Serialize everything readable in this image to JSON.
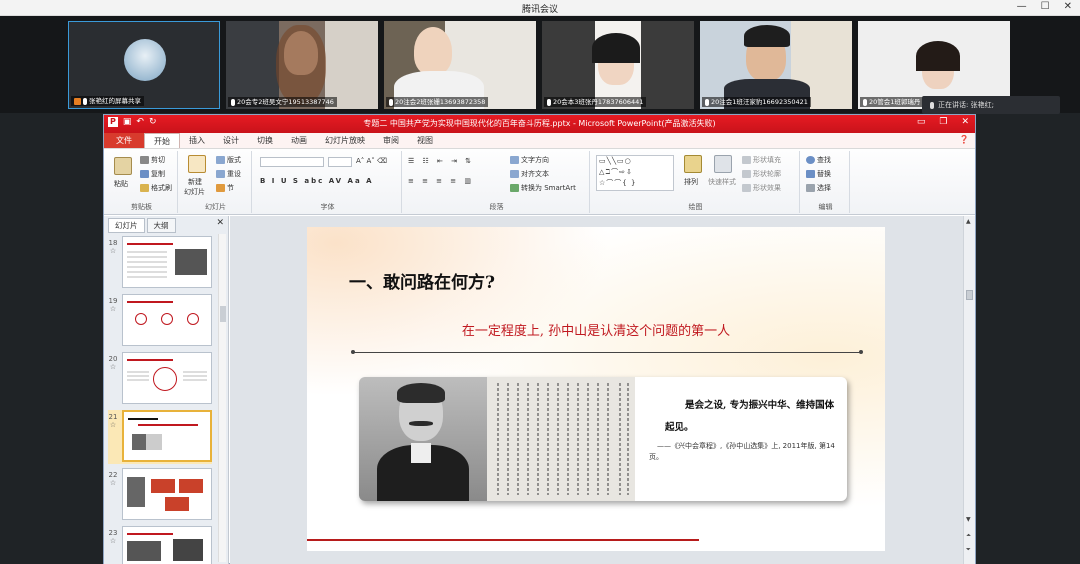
{
  "meeting": {
    "window_title": "腾讯会议",
    "speaking_label": "正在讲话: 张艳红;",
    "participants": [
      {
        "name": "张艳红的屏幕共享"
      },
      {
        "name": "20会专2班吴文宁19513387746"
      },
      {
        "name": "20注会2班张姗13693872358"
      },
      {
        "name": "20会本3班张丹17837606441"
      },
      {
        "name": "20注会1班汪家豹16692350421"
      },
      {
        "name": "20管会1班郭瑞丹"
      }
    ]
  },
  "ppt": {
    "doc_title": "专题二 中国共产党为实现中国现代化的百年奋斗历程.pptx - Microsoft PowerPoint(产品激活失败)",
    "tabs": [
      "文件",
      "开始",
      "插入",
      "设计",
      "切换",
      "动画",
      "幻灯片放映",
      "审阅",
      "视图"
    ],
    "selected_tab": "开始",
    "ribbon": {
      "clipboard": {
        "name": "剪贴板",
        "paste": "粘贴",
        "cut": "剪切",
        "copy": "复制",
        "format_painter": "格式刷"
      },
      "slides": {
        "name": "幻灯片",
        "new_slide_1": "新建",
        "new_slide_2": "幻灯片",
        "layout": "版式",
        "reset": "重设",
        "section": "节"
      },
      "font": {
        "name": "字体",
        "buttons": "B I U S abc AV Aa A"
      },
      "paragraph": {
        "name": "段落",
        "text_direction": "文字方向",
        "align_text": "对齐文本",
        "smartart": "转换为 SmartArt"
      },
      "drawing": {
        "name": "绘图",
        "arrange": "排列",
        "quick_styles": "快速样式",
        "shape_fill": "形状填充",
        "shape_outline": "形状轮廓",
        "shape_effects": "形状效果"
      },
      "editing": {
        "name": "编辑",
        "find": "查找",
        "replace": "替换",
        "select": "选择"
      }
    },
    "panel": {
      "tabs": [
        "幻灯片",
        "大纲"
      ],
      "close": "✕"
    },
    "thumbs": [
      {
        "num": "18",
        "star": "☆"
      },
      {
        "num": "19",
        "star": "☆"
      },
      {
        "num": "20",
        "star": "☆"
      },
      {
        "num": "21",
        "star": "☆"
      },
      {
        "num": "22",
        "star": "☆"
      },
      {
        "num": "23",
        "star": "☆"
      }
    ],
    "current_thumb": "21"
  },
  "slide": {
    "heading": "一、敢问路在何方?",
    "subheading": "在一定程度上, 孙中山是认清这个问题的第一人",
    "quote": "是会之设, 专为振兴中华、维持国体起见。",
    "citation": "——《兴中会章程》,《孙中山选集》上, 2011年版, 第14页。"
  },
  "colors": {
    "ppt_red": "#d83b2d",
    "slide_red": "#c0181f",
    "active_border": "#3a9ad9"
  },
  "icons": [
    "minimize-icon",
    "maximize-icon",
    "close-icon",
    "mic-icon",
    "share-icon",
    "help-icon",
    "scroll-arrow-icon"
  ]
}
